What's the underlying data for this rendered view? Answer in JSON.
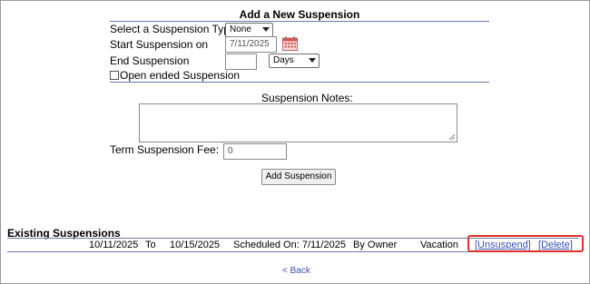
{
  "form": {
    "title": "Add a New Suspension",
    "type_label": "Select a Suspension Type",
    "type_value": "None",
    "start_label": "Start Suspension on",
    "start_value": "7/11/2025",
    "end_label": "End Suspension",
    "end_value": "",
    "end_unit": "Days",
    "open_ended_label": "Open ended Suspension",
    "open_ended_checked": false,
    "notes_label": "Suspension Notes:",
    "notes_value": "",
    "fee_label": "Term Suspension Fee:",
    "fee_value": "0",
    "submit_label": "Add Suspension"
  },
  "existing": {
    "title": "Existing Suspensions",
    "rows": [
      {
        "from": "10/11/2025",
        "to_label": "To",
        "to": "10/15/2025",
        "scheduled": "Scheduled On: 7/11/2025",
        "by": "By Owner",
        "type": "Vacation",
        "unsuspend_label": "[Unsuspend]",
        "delete_label": "[Delete]"
      }
    ]
  },
  "nav": {
    "back_label": "< Back"
  },
  "colors": {
    "link": "#3a4fb4",
    "highlight": "#e0312c",
    "rule": "#6b7ba8"
  },
  "icons": {
    "calendar": "calendar-icon",
    "dropdown": "chevron-down-icon"
  }
}
